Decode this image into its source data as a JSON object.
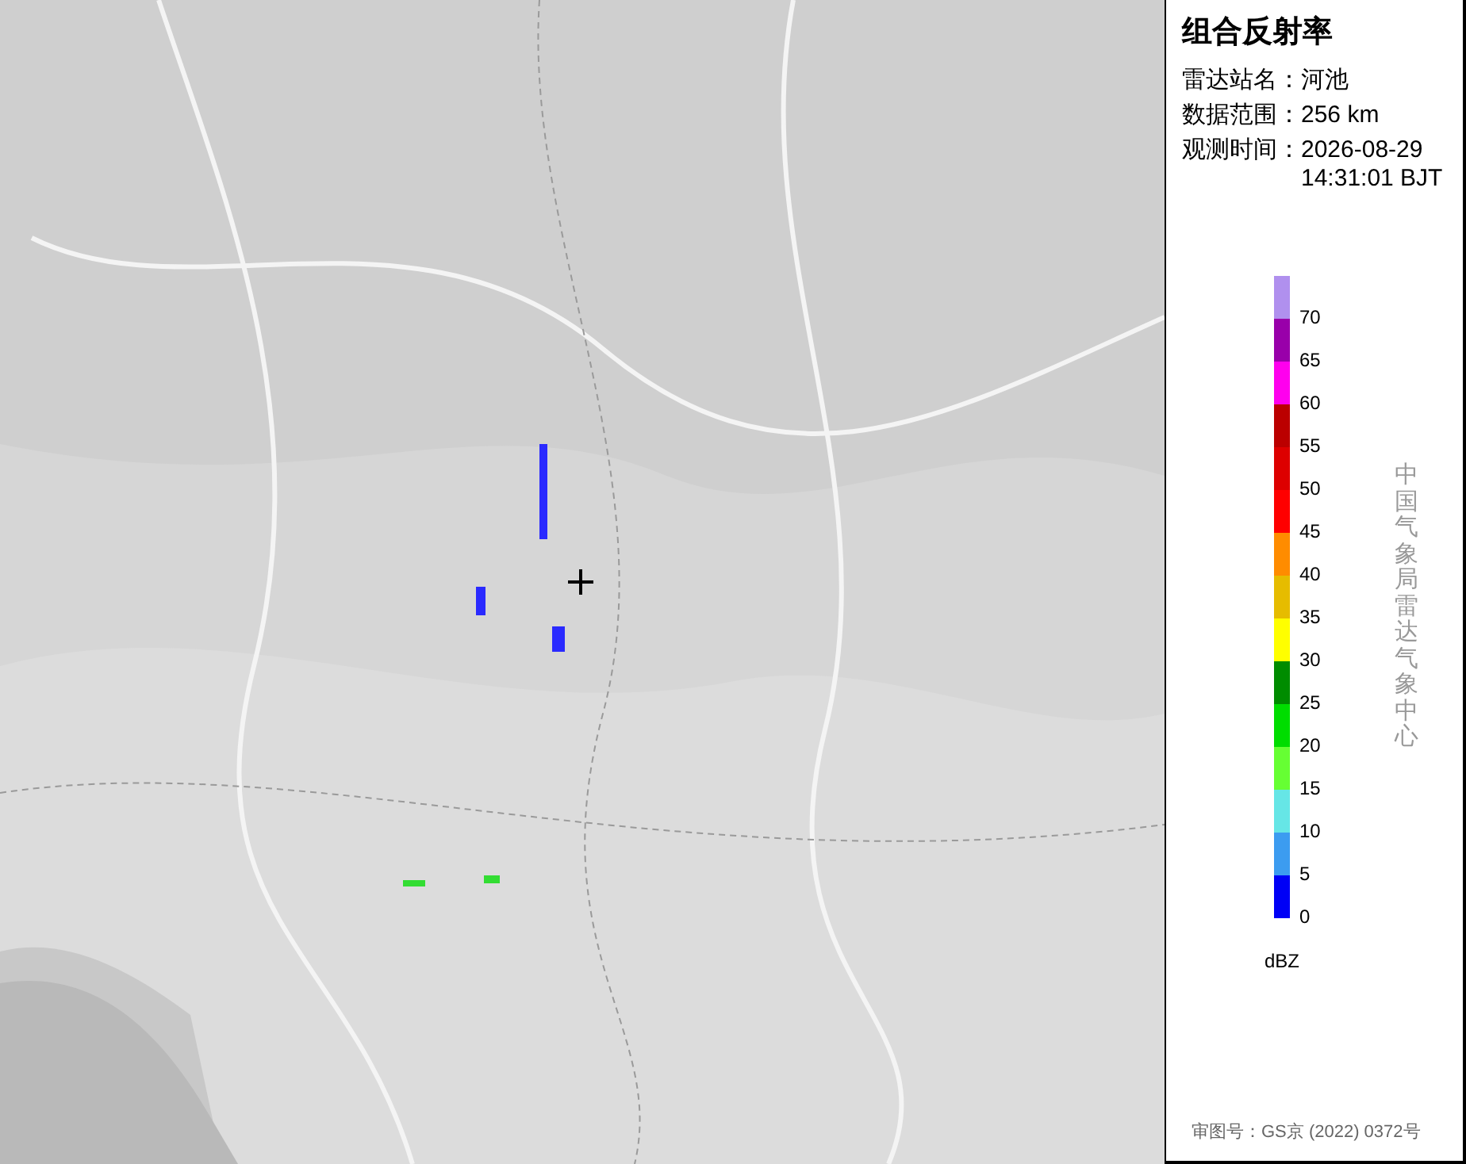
{
  "panel": {
    "title": "组合反射率",
    "fields": [
      {
        "label": "雷达站名：",
        "value": "河池"
      },
      {
        "label": "数据范围：",
        "value": "256 km"
      },
      {
        "label": "观测时间：",
        "value": "2026-08-29 14:31:01 BJT"
      }
    ],
    "legend": {
      "segments": [
        {
          "color": "#b090ee",
          "label": "70"
        },
        {
          "color": "#9900aa",
          "label": "65"
        },
        {
          "color": "#ff00ee",
          "label": "60"
        },
        {
          "color": "#bb0000",
          "label": "55"
        },
        {
          "color": "#dd0000",
          "label": "50"
        },
        {
          "color": "#ff0000",
          "label": "45"
        },
        {
          "color": "#ff8c00",
          "label": "40"
        },
        {
          "color": "#e6bc00",
          "label": "35"
        },
        {
          "color": "#ffff00",
          "label": "30"
        },
        {
          "color": "#008c00",
          "label": "25"
        },
        {
          "color": "#00dd00",
          "label": "20"
        },
        {
          "color": "#66ff33",
          "label": "15"
        },
        {
          "color": "#66e6e6",
          "label": "10"
        },
        {
          "color": "#3c9cf0",
          "label": "5"
        },
        {
          "color": "#0000f6",
          "label": "0"
        }
      ],
      "unit": "dBZ"
    },
    "credit": "中国气象局雷达气象中心",
    "approval": "审图号：GS京 (2022) 0372号"
  }
}
